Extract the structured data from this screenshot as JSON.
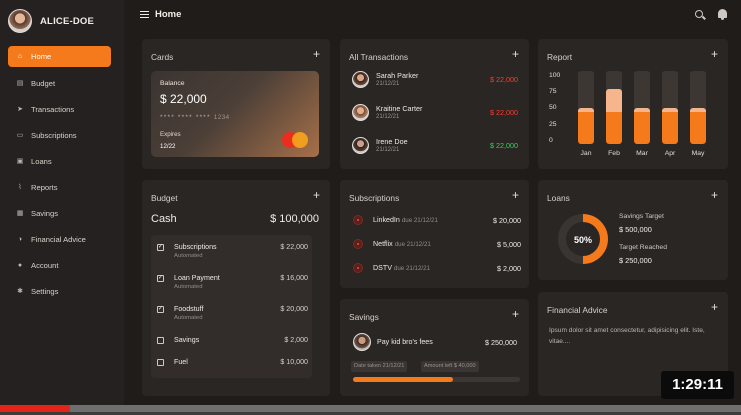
{
  "user": {
    "name": "ALICE-DOE"
  },
  "header": {
    "title": "Home"
  },
  "nav": [
    {
      "label": "Home",
      "icon": "home-icon",
      "glyph": "⌂",
      "active": true
    },
    {
      "label": "Budget",
      "icon": "budget-icon",
      "glyph": "▤"
    },
    {
      "label": "Transactions",
      "icon": "send-icon",
      "glyph": "➤"
    },
    {
      "label": "Subscriptions",
      "icon": "folder-icon",
      "glyph": "▭"
    },
    {
      "label": "Loans",
      "icon": "loan-icon",
      "glyph": "▣"
    },
    {
      "label": "Reports",
      "icon": "chart-icon",
      "glyph": "⌇"
    },
    {
      "label": "Savings",
      "icon": "wallet-icon",
      "glyph": "▦"
    },
    {
      "label": "Financial Advice",
      "icon": "advice-icon",
      "glyph": "◑"
    },
    {
      "label": "Account",
      "icon": "user-icon",
      "glyph": "●"
    },
    {
      "label": "Settings",
      "icon": "gear-icon",
      "glyph": "✱"
    }
  ],
  "cards": {
    "title": "Cards",
    "balance_label": "Balance",
    "balance": "$ 22,000",
    "number_masked": "**** **** ****",
    "number_last": "1234",
    "expires_label": "Expires",
    "expires": "12/22"
  },
  "transactions": {
    "title": "All Transactions",
    "items": [
      {
        "name": "Sarah Parker",
        "date": "21/12/21",
        "amount": "$ 22,000",
        "color": "#ff3b30"
      },
      {
        "name": "Kraitine Carter",
        "date": "21/12/21",
        "amount": "$ 22,000",
        "color": "#ff3b30"
      },
      {
        "name": "Irene Doe",
        "date": "21/12/21",
        "amount": "$ 22,000",
        "color": "#34d25a"
      }
    ]
  },
  "report": {
    "title": "Report"
  },
  "chart_data": {
    "type": "bar",
    "title": "Report",
    "categories": [
      "Jan",
      "Feb",
      "Mar",
      "Apr",
      "May"
    ],
    "values": [
      50,
      75,
      50,
      50,
      50
    ],
    "y_ticks": [
      "100",
      "75",
      "50",
      "25",
      "0"
    ],
    "ylim": [
      0,
      100
    ],
    "grid": false
  },
  "budget": {
    "title": "Budget",
    "head_label": "Cash",
    "head_total": "$ 100,000",
    "items": [
      {
        "name": "Subscriptions",
        "sub": "Automated",
        "amount": "$ 22,000",
        "checked": true
      },
      {
        "name": "Loan Payment",
        "sub": "Automated",
        "amount": "$ 16,000",
        "checked": true
      },
      {
        "name": "Foodstuff",
        "sub": "Automated",
        "amount": "$ 20,000",
        "checked": true
      },
      {
        "name": "Savings",
        "sub": "",
        "amount": "$ 2,000",
        "checked": false
      },
      {
        "name": "Fuel",
        "sub": "",
        "amount": "$ 10,000",
        "checked": false
      }
    ]
  },
  "subscriptions": {
    "title": "Subscriptions",
    "items": [
      {
        "name": "LinkedIn",
        "due": "due 21/12/21",
        "amount": "$ 20,000"
      },
      {
        "name": "Netflix",
        "due": "due 21/12/21",
        "amount": "$ 5,000"
      },
      {
        "name": "DSTV",
        "due": "due 21/12/21",
        "amount": "$ 2,000"
      }
    ]
  },
  "loans": {
    "title": "Loans",
    "percent": 50,
    "percent_label": "50%",
    "target_label": "Savings Target",
    "target_value": "$ 500,000",
    "reached_label": "Target Reached",
    "reached_value": "$ 250,000"
  },
  "savings": {
    "title": "Savings",
    "name": "Pay kid bro's fees",
    "amount": "$ 250,000",
    "date_chip": "Date taken 21/12/21",
    "left_chip": "Amount left $ 40,000",
    "progress": 0.6
  },
  "advice": {
    "title": "Financial Advice",
    "text": "Ipsum dolor sit amet consectetur, adipisicing elit. Iste, vitae...."
  },
  "video": {
    "time": "1:29:11",
    "played_fraction": 0.095
  },
  "colors": {
    "accent": "#f47a1c",
    "negative": "#ff3b30",
    "positive": "#34d25a"
  }
}
